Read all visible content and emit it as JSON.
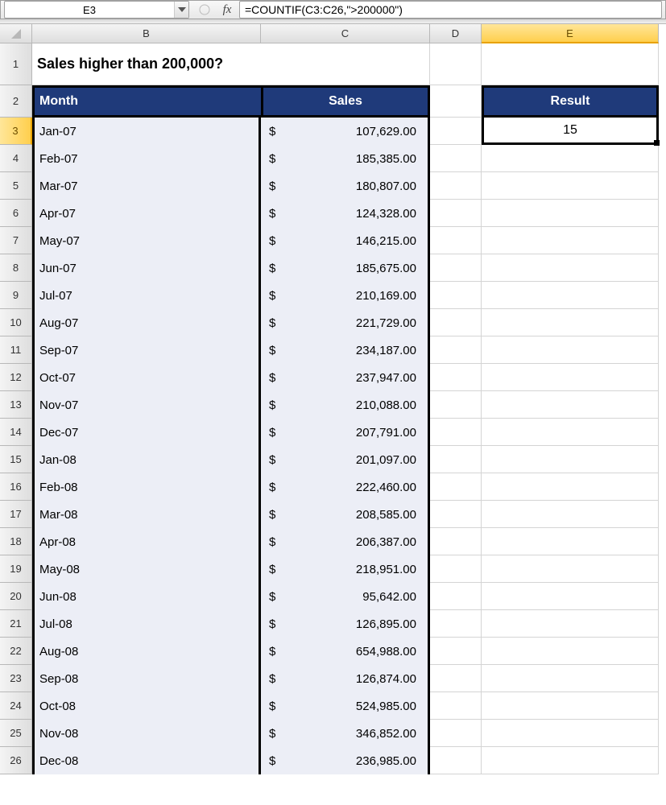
{
  "formula_bar": {
    "name_box": "E3",
    "cancel_icon": "✕",
    "fx_label": "fx",
    "formula": "=COUNTIF(C3:C26,\">200000\")"
  },
  "columns": [
    "B",
    "C",
    "D",
    "E"
  ],
  "active_column": "E",
  "active_row": 3,
  "title": "Sales higher than 200,000?",
  "headers": {
    "month": "Month",
    "sales": "Sales",
    "result": "Result"
  },
  "result_value": "15",
  "rows": [
    {
      "n": 3,
      "month": "Jan-07",
      "sales": "107,629.00"
    },
    {
      "n": 4,
      "month": "Feb-07",
      "sales": "185,385.00"
    },
    {
      "n": 5,
      "month": "Mar-07",
      "sales": "180,807.00"
    },
    {
      "n": 6,
      "month": "Apr-07",
      "sales": "124,328.00"
    },
    {
      "n": 7,
      "month": "May-07",
      "sales": "146,215.00"
    },
    {
      "n": 8,
      "month": "Jun-07",
      "sales": "185,675.00"
    },
    {
      "n": 9,
      "month": "Jul-07",
      "sales": "210,169.00"
    },
    {
      "n": 10,
      "month": "Aug-07",
      "sales": "221,729.00"
    },
    {
      "n": 11,
      "month": "Sep-07",
      "sales": "234,187.00"
    },
    {
      "n": 12,
      "month": "Oct-07",
      "sales": "237,947.00"
    },
    {
      "n": 13,
      "month": "Nov-07",
      "sales": "210,088.00"
    },
    {
      "n": 14,
      "month": "Dec-07",
      "sales": "207,791.00"
    },
    {
      "n": 15,
      "month": "Jan-08",
      "sales": "201,097.00"
    },
    {
      "n": 16,
      "month": "Feb-08",
      "sales": "222,460.00"
    },
    {
      "n": 17,
      "month": "Mar-08",
      "sales": "208,585.00"
    },
    {
      "n": 18,
      "month": "Apr-08",
      "sales": "206,387.00"
    },
    {
      "n": 19,
      "month": "May-08",
      "sales": "218,951.00"
    },
    {
      "n": 20,
      "month": "Jun-08",
      "sales": "95,642.00"
    },
    {
      "n": 21,
      "month": "Jul-08",
      "sales": "126,895.00"
    },
    {
      "n": 22,
      "month": "Aug-08",
      "sales": "654,988.00"
    },
    {
      "n": 23,
      "month": "Sep-08",
      "sales": "126,874.00"
    },
    {
      "n": 24,
      "month": "Oct-08",
      "sales": "524,985.00"
    },
    {
      "n": 25,
      "month": "Nov-08",
      "sales": "346,852.00"
    },
    {
      "n": 26,
      "month": "Dec-08",
      "sales": "236,985.00"
    }
  ],
  "currency_symbol": "$"
}
